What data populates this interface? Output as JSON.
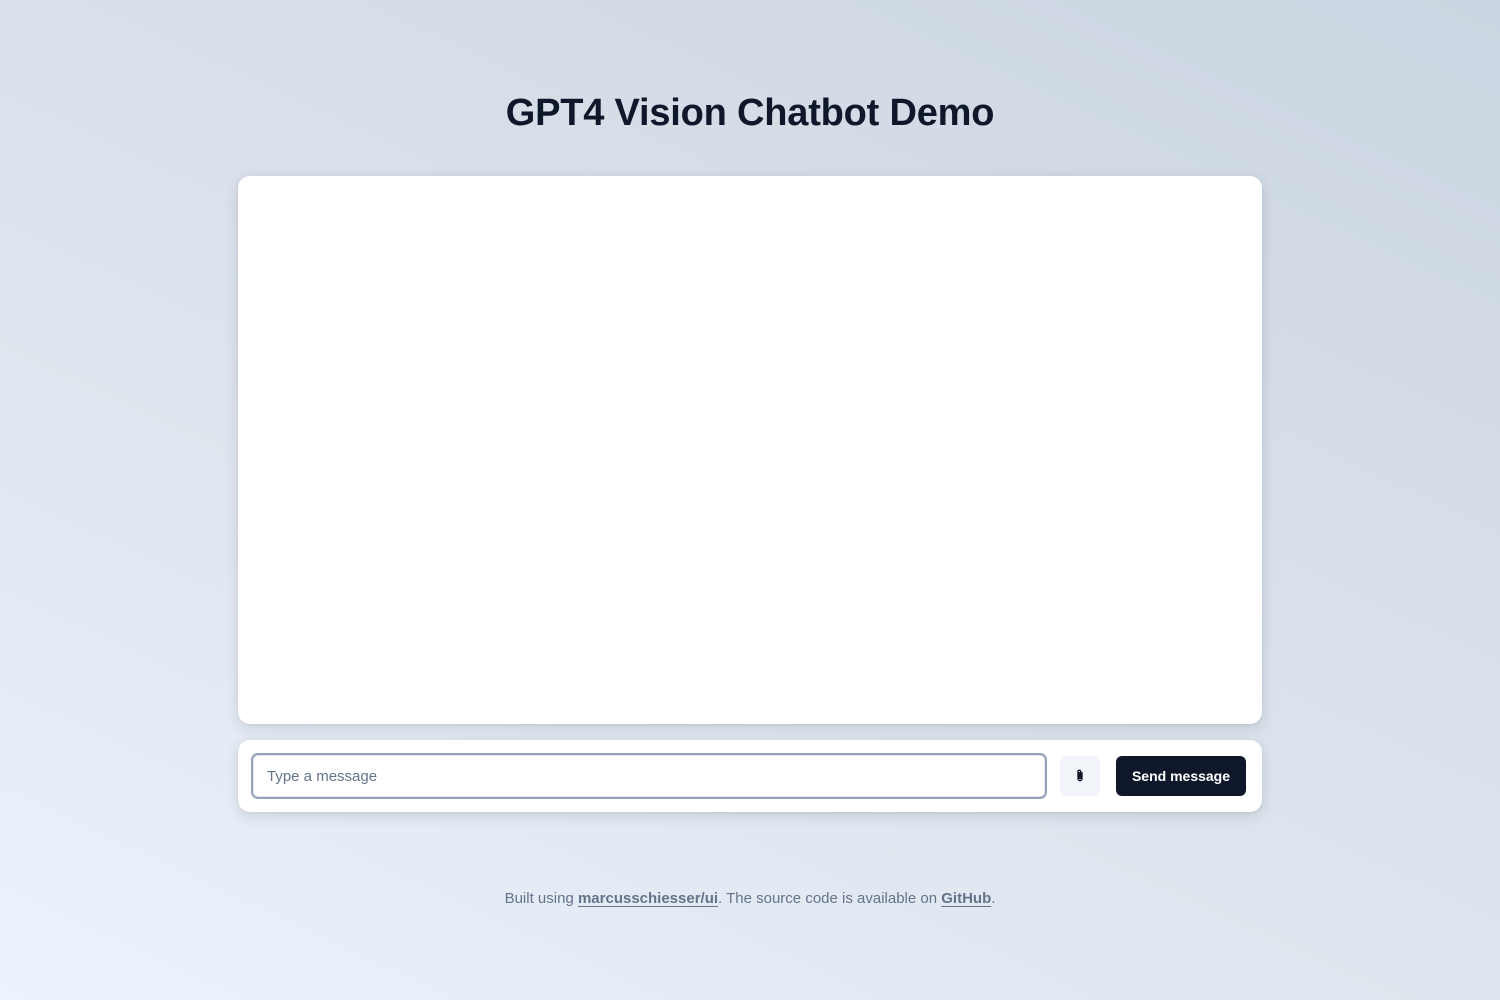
{
  "header": {
    "title": "GPT4 Vision Chatbot Demo"
  },
  "chat": {
    "messages": []
  },
  "composer": {
    "input_value": "",
    "input_placeholder": "Type a message",
    "attach_icon": "paperclip-icon",
    "send_label": "Send message"
  },
  "footer": {
    "prefix": "Built using ",
    "link1_text": "marcusschiesser/ui",
    "middle": ". The source code is available on ",
    "link2_text": "GitHub",
    "suffix": "."
  },
  "colors": {
    "primary": "#0f172a",
    "muted_text": "#64748b",
    "input_border": "#94a3b8",
    "attach_bg": "#f1f5f9",
    "panel_bg": "#ffffff"
  }
}
